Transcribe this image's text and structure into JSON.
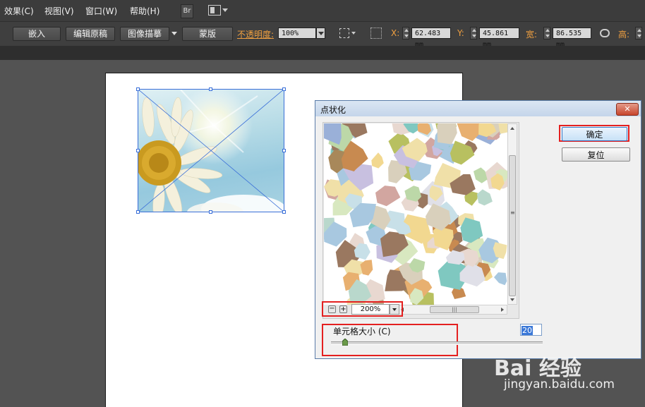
{
  "menu": {
    "items": [
      "效果(C)",
      "视图(V)",
      "窗口(W)",
      "帮助(H)"
    ],
    "bridge_label": "Br"
  },
  "control_bar": {
    "embed_label": "嵌入",
    "edit_original_label": "编辑原稿",
    "image_trace_label": "图像描摹",
    "mask_label": "蒙版",
    "opacity_label": "不透明度:",
    "opacity_value": "100%",
    "x_label": "X:",
    "x_value": "62.483 mm",
    "y_label": "Y:",
    "y_value": "45.861 mm",
    "width_label": "宽:",
    "width_value": "86.535 mm",
    "height_label": "高:"
  },
  "dialog": {
    "title": "点状化",
    "close_label": "✕",
    "ok_label": "确定",
    "reset_label": "复位",
    "zoom_value": "200%",
    "cell_size_label": "单元格大小 (C)",
    "cell_size_value": "20",
    "scroll_grip": "|||",
    "scroll_grip_v": "≡"
  },
  "watermark": {
    "logo_text": "Bai 经验",
    "url": "jingyan.baidu.com"
  },
  "colors": {
    "accent_orange": "#f0a040",
    "highlight_red": "#e42020",
    "selection_blue": "#3a6fd8"
  }
}
